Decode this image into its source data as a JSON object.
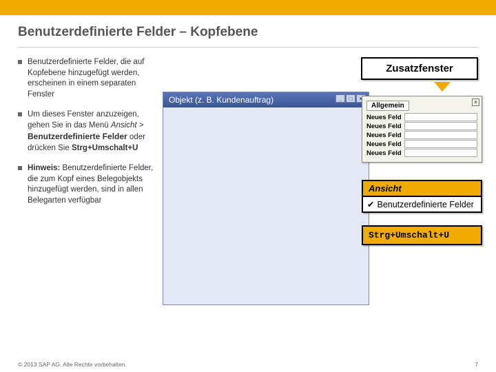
{
  "title": "Benutzerdefinierte Felder – Kopfebene",
  "bullets": {
    "b1": "Benutzerdefinierte Felder, die auf Kopfebene hinzugefügt werden, erscheinen in einem separaten Fenster",
    "b2a": "Um dieses Fenster anzuzeigen, gehen Sie in das Menü ",
    "b2b": "Ansicht > ",
    "b2c": "Benutzerdefinierte Felder",
    "b2d": " oder drücken Sie ",
    "b2e": "Strg+Umschalt+U",
    "b3a": "Hinweis:",
    "b3b": " Benutzerdefinierte Felder, die zum Kopf eines Belegobjekts hinzugefügt werden, sind in allen Belegarten verfügbar"
  },
  "window": {
    "title": "Objekt (z. B. Kundenauftrag)"
  },
  "subpanel": {
    "tab": "Allgemein",
    "rows": [
      "Neues Feld",
      "Neues Feld",
      "Neues Feld",
      "Neues Feld",
      "Neues Feld"
    ]
  },
  "callouts": {
    "zusatz": "Zusatzfenster",
    "ansicht_head": "Ansicht",
    "ansicht_item": "Benutzerdefinierte Felder",
    "shortcut": "Strg+Umschalt+U"
  },
  "footer": {
    "left": "© 2013 SAP AG. Alle Rechte vorbehalten.",
    "right": "7"
  }
}
